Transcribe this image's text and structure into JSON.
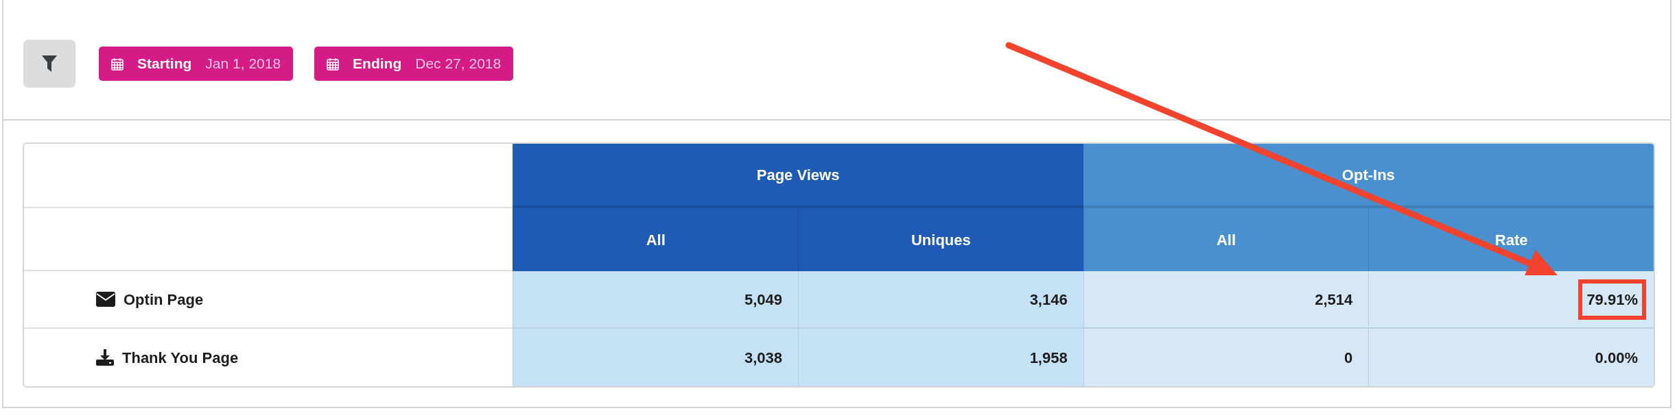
{
  "filters": [
    {
      "label": "Starting",
      "value": "Jan 1, 2018"
    },
    {
      "label": "Ending",
      "value": "Dec 27, 2018"
    }
  ],
  "table": {
    "groups": [
      {
        "title": "Page Views",
        "kind": "dark",
        "columns": [
          "All",
          "Uniques"
        ]
      },
      {
        "title": "Opt-Ins",
        "kind": "light",
        "columns": [
          "All",
          "Rate"
        ]
      }
    ],
    "rows": [
      {
        "name": "Optin Page",
        "kind": "envelope",
        "cells": [
          {
            "text": "5,049",
            "highlighted": false
          },
          {
            "text": "3,146",
            "highlighted": false
          },
          {
            "text": "2,514",
            "highlighted": false
          },
          {
            "text": "79.91%",
            "highlighted": true
          }
        ]
      },
      {
        "name": "Thank You Page",
        "kind": "download",
        "cells": [
          {
            "text": "3,038",
            "highlighted": false
          },
          {
            "text": "1,958",
            "highlighted": false
          },
          {
            "text": "0",
            "highlighted": false
          },
          {
            "text": "0.00%",
            "highlighted": false
          }
        ]
      }
    ]
  },
  "annotation": {
    "arrow": true
  }
}
